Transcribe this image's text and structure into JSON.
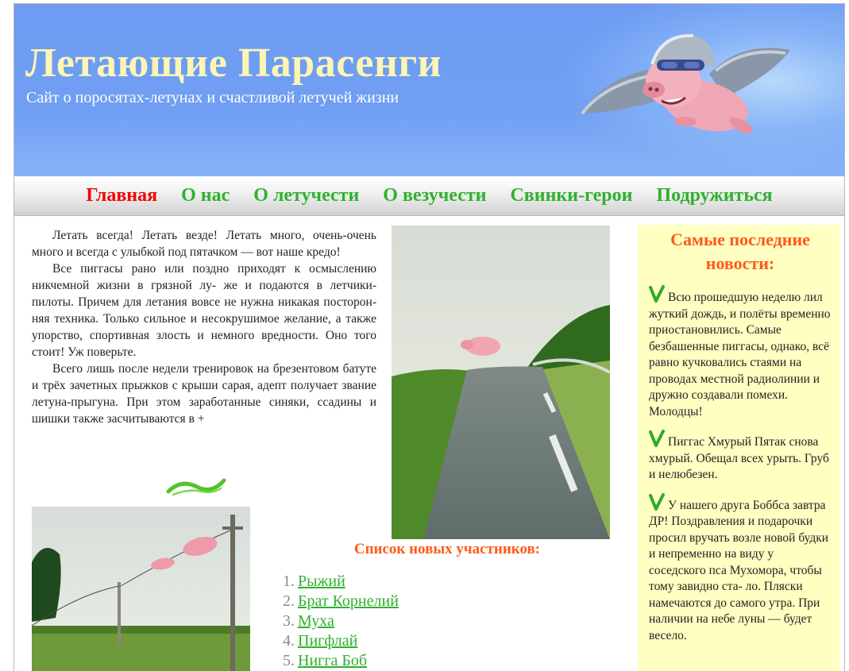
{
  "header": {
    "title": "Летающие Парасенги",
    "subtitle": "Сайт о поросятах-летунах и счастливой летучей жизни"
  },
  "nav": {
    "items": [
      {
        "label": "Главная",
        "active": true
      },
      {
        "label": "О нас",
        "active": false
      },
      {
        "label": "О летучести",
        "active": false
      },
      {
        "label": "О везучести",
        "active": false
      },
      {
        "label": "Свинки-герои",
        "active": false
      },
      {
        "label": "Подружиться",
        "active": false
      }
    ]
  },
  "article": {
    "paragraphs": [
      "Летать всегда! Летать везде! Летать много, очень-очень много и всегда с улыбкой под пятачком — вот наше кредо!",
      "Все пиггасы рано или поздно приходят к осмыслению никчемной жизни в грязной лу- же и подаются в летчики-пилоты. Причем для летания вовсе не нужна никакая посторон- няя техника. Только сильное и несокрушимое желание, а также упорство, спортивная злость и немного вредности. Оно того стоит! Уж поверьте.",
      "Всего лишь после недели тренировок на брезентовом батуте и трёх зачетных прыжков с крыши сарая, адепт получает звание летуна-прыгуна. При этом заработанные синяки, ссадины и шишки также засчитываются в +"
    ]
  },
  "members": {
    "title": "Список новых участников:",
    "list": [
      {
        "num": "1.",
        "name": "Рыжий"
      },
      {
        "num": "2.",
        "name": "Брат Корнелий"
      },
      {
        "num": "3.",
        "name": "Муха"
      },
      {
        "num": "4.",
        "name": "Пигфлай"
      },
      {
        "num": "5.",
        "name": "Нигга Боб"
      }
    ]
  },
  "news": {
    "title": "Самые последние новости:",
    "items": [
      "Всю прошедшую неделю лил жуткий дождь, и полёты временно приостановились. Самые безбашенные пиггасы, однако, всё равно кучковались стаями на проводах местной радиолинии и дружно создавали помехи. Молодцы!",
      "Пиггас Хмурый Пятак снова хмурый. Обещал всех урыть. Груб и нелюбезен.",
      "У нашего друга Боббса завтра ДР! Поздравления и подарочки просил вручать возле новой будки и непременно на виду у соседского пса Мухомора, чтобы тому завидно ста- ло. Пляски намечаются до самого утра. При наличии на небе луны — будет весело."
    ]
  },
  "colors": {
    "header_bg": "#6e9cf2",
    "title": "#fdf5b4",
    "nav_link": "#2fb12f",
    "nav_active": "#f40000",
    "heading_orange": "#ff5a1a",
    "news_bg": "#ffffc2"
  },
  "icons": {
    "news_bullet": "green-check-icon",
    "divider": "swirl-ornament-icon"
  }
}
